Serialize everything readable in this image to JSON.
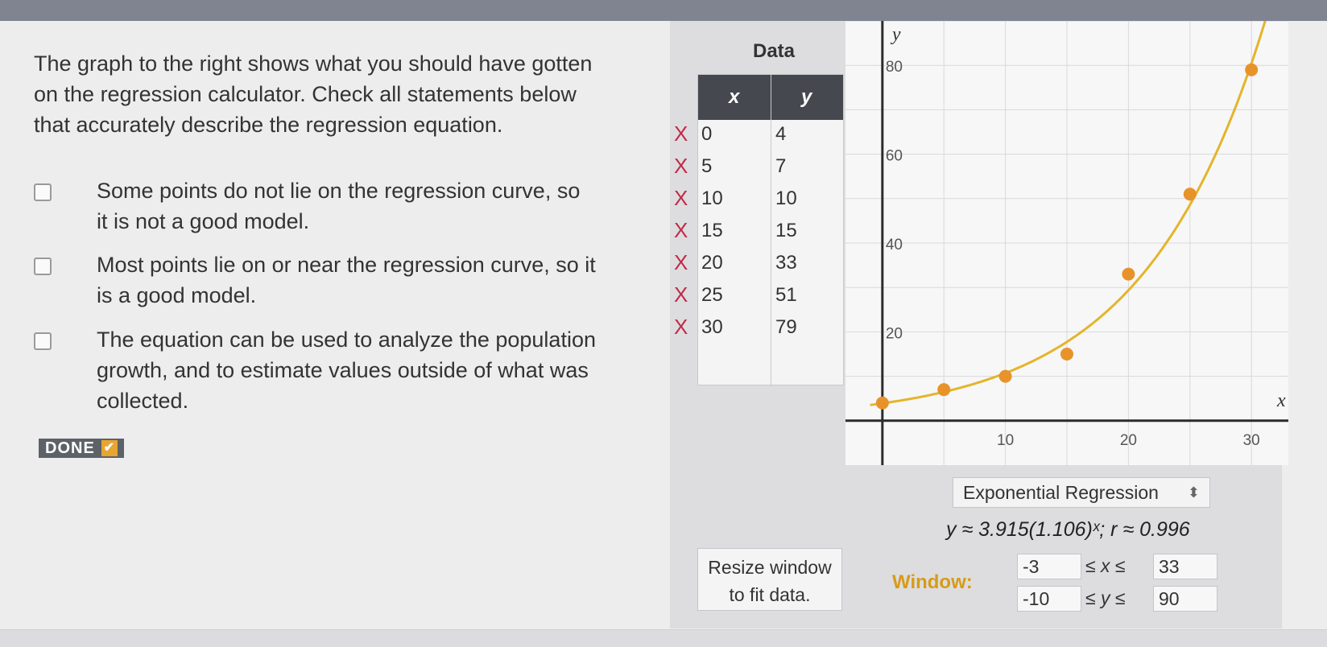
{
  "prompt": "The graph to the right shows what you should have gotten on the regression calculator. Check all statements below that accurately describe the regression equation.",
  "options": [
    {
      "label": "Some points do not lie on the regression curve, so it is not a good model.",
      "checked": false
    },
    {
      "label": "Most points lie on or near the regression curve, so it is a good model.",
      "checked": false
    },
    {
      "label": "The equation can be used to analyze the population growth, and to estimate values outside of what was collected.",
      "checked": false
    }
  ],
  "done_label": "DONE",
  "data_panel": {
    "title": "Data",
    "col_x": "x",
    "col_y": "y",
    "remove_mark": "X",
    "rows": [
      {
        "x": "0",
        "y": "4"
      },
      {
        "x": "5",
        "y": "7"
      },
      {
        "x": "10",
        "y": "10"
      },
      {
        "x": "15",
        "y": "15"
      },
      {
        "x": "20",
        "y": "33"
      },
      {
        "x": "25",
        "y": "51"
      },
      {
        "x": "30",
        "y": "79"
      }
    ]
  },
  "chart_data": {
    "type": "scatter",
    "xlabel": "x",
    "ylabel": "y",
    "xlim": [
      -3,
      33
    ],
    "ylim": [
      -10,
      90
    ],
    "x_ticks": [
      10,
      20,
      30
    ],
    "y_ticks": [
      20,
      40,
      60,
      80
    ],
    "grid": true,
    "points": {
      "x": [
        0,
        5,
        10,
        15,
        20,
        25,
        30
      ],
      "y": [
        4,
        7,
        10,
        15,
        33,
        51,
        79
      ]
    },
    "curve": {
      "a": 3.915,
      "b": 1.106
    },
    "colors": {
      "points": "#e8932a",
      "curve": "#e3b52a",
      "axis": "#2b2b2b",
      "grid": "#d9d9dc"
    }
  },
  "regression": {
    "type_label": "Exponential Regression",
    "equation": "y ≈ 3.915(1.106)ˣ; r ≈ 0.996"
  },
  "resize_label": "Resize window to fit data.",
  "window": {
    "label": "Window:",
    "xmin": "-3",
    "xmax": "33",
    "x_rel": "≤ x ≤",
    "ymin": "-10",
    "ymax": "90",
    "y_rel": "≤ y ≤"
  }
}
